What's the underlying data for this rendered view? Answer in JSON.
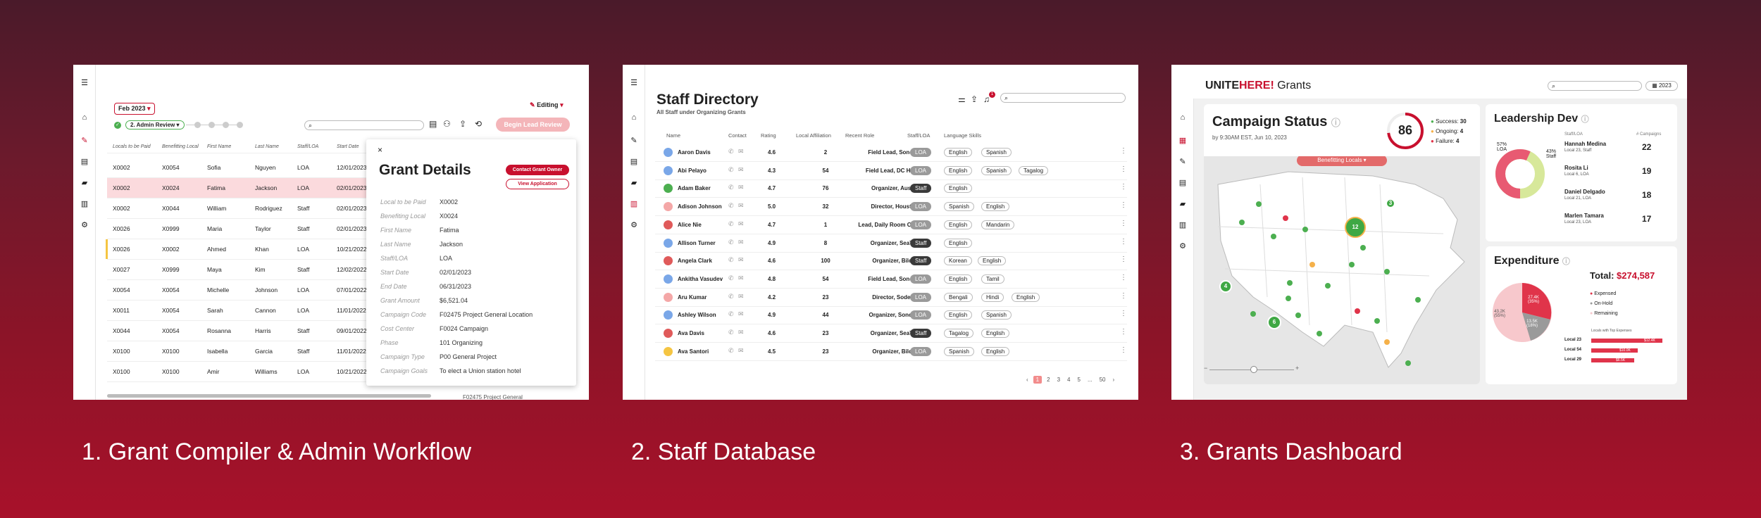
{
  "captions": [
    "1. Grant Compiler & Admin Workflow",
    "2. Staff Database",
    "3. Grants Dashboard"
  ],
  "p1": {
    "month": "Feb 2023",
    "stage": "2. Admin Review",
    "editing": "Editing",
    "begin_button": "Begin Lead Review",
    "columns": [
      "Locals to be Paid",
      "Benefitting Local",
      "First Name",
      "Last Name",
      "Staff/LOA",
      "Start Date"
    ],
    "rows": [
      [
        "X0002",
        "X0054",
        "Sofia",
        "Nguyen",
        "LOA",
        "12/01/2023"
      ],
      [
        "X0002",
        "X0024",
        "Fatima",
        "Jackson",
        "LOA",
        "02/01/2023"
      ],
      [
        "X0002",
        "X0044",
        "William",
        "Rodriguez",
        "Staff",
        "02/01/2023"
      ],
      [
        "X0026",
        "X0999",
        "Maria",
        "Taylor",
        "Staff",
        "02/01/2023"
      ],
      [
        "X0026",
        "X0002",
        "Ahmed",
        "Khan",
        "LOA",
        "10/21/2022"
      ],
      [
        "X0027",
        "X0999",
        "Maya",
        "Kim",
        "Staff",
        "12/02/2022"
      ],
      [
        "X0054",
        "X0054",
        "Michelle",
        "Johnson",
        "LOA",
        "07/01/2022"
      ],
      [
        "X0011",
        "X0054",
        "Sarah",
        "Cannon",
        "LOA",
        "11/01/2022"
      ],
      [
        "X0044",
        "X0054",
        "Rosanna",
        "Harris",
        "Staff",
        "09/01/2022"
      ],
      [
        "X0100",
        "X0100",
        "Isabella",
        "Garcia",
        "Staff",
        "11/01/2022"
      ],
      [
        "X0100",
        "X0100",
        "Amir",
        "Williams",
        "LOA",
        "10/21/2022"
      ]
    ],
    "detail": {
      "close": "×",
      "title": "Grant Details",
      "contact_button": "Contact Grant Owner",
      "view_button": "View Application",
      "fields": [
        [
          "Local to be Paid",
          "X0002"
        ],
        [
          "Benefiting Local",
          "X0024"
        ],
        [
          "First Name",
          "Fatima"
        ],
        [
          "Last Name",
          "Jackson"
        ],
        [
          "Staff/LOA",
          "LOA"
        ],
        [
          "Start Date",
          "02/01/2023"
        ],
        [
          "End Date",
          "06/31/2023"
        ],
        [
          "Grant Amount",
          "$6,521.04"
        ],
        [
          "Campaign Code",
          "F02475 Project General Location"
        ],
        [
          "Cost Center",
          "F0024 Campaign"
        ],
        [
          "Phase",
          "101 Organizing"
        ],
        [
          "Campaign Type",
          "P00 General Project"
        ],
        [
          "Campaign Goals",
          "To elect a Union station hotel"
        ]
      ]
    },
    "overflow_text": "F02475 Project General"
  },
  "p2": {
    "title": "Staff Directory",
    "subtitle": "All Staff under Organizing Grants",
    "columns": [
      "Name",
      "Contact",
      "Rating",
      "Local Affiliation",
      "Recent Role",
      "Staff/LOA",
      "Language Skills"
    ],
    "rows": [
      {
        "name": "Aaron Davis",
        "rating": "4.6",
        "local": "2",
        "role": "Field Lead, Sonoma",
        "type": "LOA",
        "langs": [
          "English",
          "Spanish"
        ],
        "color": "#7aa7e8"
      },
      {
        "name": "Abi Pelayo",
        "rating": "4.3",
        "local": "54",
        "role": "Field Lead, DC Hotels",
        "type": "LOA",
        "langs": [
          "English",
          "Spanish",
          "Tagalog"
        ],
        "color": "#7aa7e8"
      },
      {
        "name": "Adam Baker",
        "rating": "4.7",
        "local": "76",
        "role": "Organizer, Austin",
        "type": "Staff",
        "langs": [
          "English"
        ],
        "color": "#4caf50"
      },
      {
        "name": "Adison Johnson",
        "rating": "5.0",
        "local": "32",
        "role": "Director, Houston",
        "type": "LOA",
        "langs": [
          "Spanish",
          "English"
        ],
        "color": "#f4a7a7"
      },
      {
        "name": "Alice Nie",
        "rating": "4.7",
        "local": "1",
        "role": "Lead, Daily Room Cleaning",
        "type": "LOA",
        "langs": [
          "English",
          "Mandarin"
        ],
        "color": "#e05a5a"
      },
      {
        "name": "Allison Turner",
        "rating": "4.9",
        "local": "8",
        "role": "Organizer, SeaTac",
        "type": "Staff",
        "langs": [
          "English"
        ],
        "color": "#7aa7e8"
      },
      {
        "name": "Angela Clark",
        "rating": "4.6",
        "local": "100",
        "role": "Organizer, Biloxi",
        "type": "Staff",
        "langs": [
          "Korean",
          "English"
        ],
        "color": "#e05a5a"
      },
      {
        "name": "Ankitha Vasudev",
        "rating": "4.8",
        "local": "54",
        "role": "Field Lead, Sonoma",
        "type": "LOA",
        "langs": [
          "English",
          "Tamil"
        ],
        "color": "#7aa7e8"
      },
      {
        "name": "Aru Kumar",
        "rating": "4.2",
        "local": "23",
        "role": "Director, Sodexo",
        "type": "LOA",
        "langs": [
          "Bengali",
          "Hindi",
          "English"
        ],
        "color": "#f4a7a7"
      },
      {
        "name": "Ashley Wilson",
        "rating": "4.9",
        "local": "44",
        "role": "Organizer, Sonoma",
        "type": "LOA",
        "langs": [
          "English",
          "Spanish"
        ],
        "color": "#7aa7e8"
      },
      {
        "name": "Ava Davis",
        "rating": "4.6",
        "local": "23",
        "role": "Organizer, SeaTac",
        "type": "Staff",
        "langs": [
          "Tagalog",
          "English"
        ],
        "color": "#e05a5a"
      },
      {
        "name": "Ava Santori",
        "rating": "4.5",
        "local": "23",
        "role": "Organizer, Biloxi",
        "type": "LOA",
        "langs": [
          "Spanish",
          "English"
        ],
        "color": "#f5c542"
      }
    ],
    "pages": [
      "‹",
      "1",
      "2",
      "3",
      "4",
      "5",
      "...",
      "50",
      "›"
    ],
    "notif_count": "1"
  },
  "p3": {
    "brand_a": "UNITE",
    "brand_b": "HERE!",
    "brand_c": " Grants",
    "year": "2023",
    "status_title": "Campaign Status",
    "status_sub": "by 9:30AM EST, Jun 10, 2023",
    "total_count": "86",
    "success_label": "Success:",
    "success_val": "30",
    "ongoing_label": "Ongoing:",
    "ongoing_val": "4",
    "failure_label": "Failure:",
    "failure_val": "4",
    "map_filter": "Benefitting Locals",
    "clusters": [
      "3",
      "4",
      "12",
      "6"
    ],
    "leader_title": "Leadership Dev",
    "leader_col1": "Staff/LOA",
    "leader_col2": "# Campaigns",
    "donut_a": "57%",
    "donut_a_lbl": "LOA",
    "donut_b": "43%",
    "donut_b_lbl": "Staff",
    "leaders": [
      {
        "name": "Hannah Medina",
        "sub": "Local 23, Staff",
        "n": "22"
      },
      {
        "name": "Rosita Li",
        "sub": "Local 6, LOA",
        "n": "19"
      },
      {
        "name": "Daniel Delgado",
        "sub": "Local 21, LOA",
        "n": "18"
      },
      {
        "name": "Marlen Tamara",
        "sub": "Local 23, LOA",
        "n": "17"
      }
    ],
    "exp_title": "Expenditure",
    "total_label": "Total:",
    "total_value": "$274,587",
    "legend": [
      "Expensed",
      "On-Hold",
      "Remaining"
    ],
    "pie_a": "27.4K",
    "pie_a_pct": "(35%)",
    "pie_b": "13.5K",
    "pie_b_pct": "(18%)",
    "pie_c": "43.2K",
    "pie_c_pct": "(55%)",
    "top_label": "Locals with Top Expenses",
    "top_rows": [
      {
        "local": "Local 23",
        "val": "$12.4K",
        "frac": 0.92
      },
      {
        "local": "Local 54",
        "val": "$10.0K",
        "frac": 0.6
      },
      {
        "local": "Local 29",
        "val": "$6.5K",
        "frac": 0.55
      }
    ],
    "colors": {
      "success": "#4caf50",
      "ongoing": "#f5b14a",
      "failure": "#e0344a",
      "accent": "#c8102e"
    }
  }
}
